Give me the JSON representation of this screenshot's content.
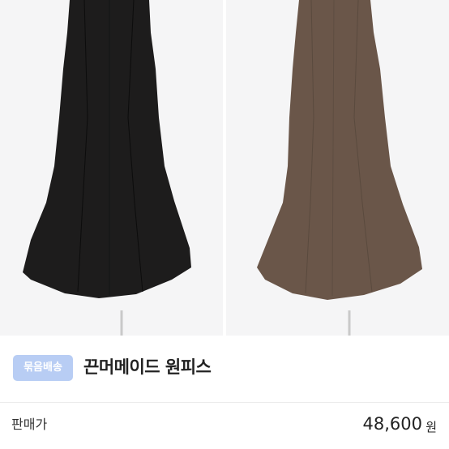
{
  "product": {
    "badge": "묶음배송",
    "title": "끈머메이드 원피스"
  },
  "price": {
    "label": "판매가",
    "value": "48,600",
    "unit": "원"
  },
  "photos": [
    {
      "color": "#1d1c1c"
    },
    {
      "color": "#6a5649"
    }
  ]
}
